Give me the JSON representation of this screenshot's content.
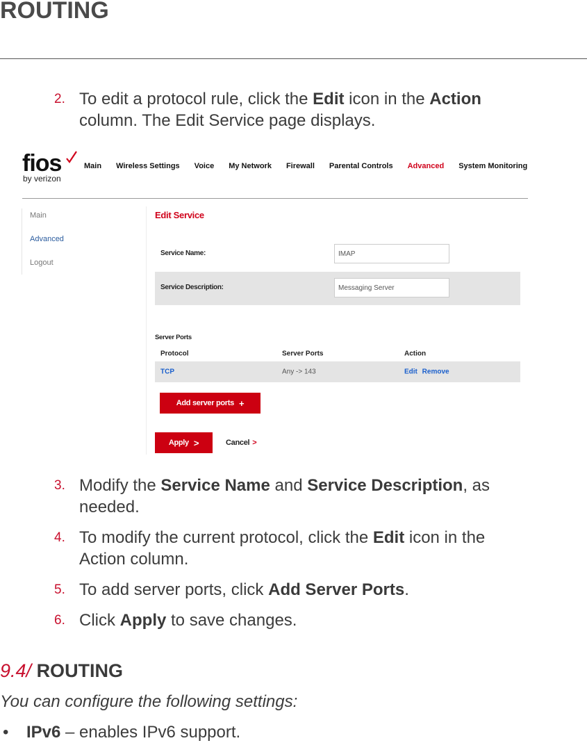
{
  "header": {
    "chapter_title": "ROUTING"
  },
  "steps_before": [
    {
      "number": "2.",
      "parts": [
        {
          "t": "To edit a protocol rule, click the "
        },
        {
          "t": "Edit",
          "b": true
        },
        {
          "t": " icon in the "
        },
        {
          "t": "Action",
          "b": true
        },
        {
          "t": " column. The Edit Service page displays."
        }
      ]
    }
  ],
  "screenshot": {
    "logo": {
      "brand": "fios",
      "sub": "by verizon",
      "check_color": "#d0021b"
    },
    "top_nav": [
      {
        "label": "Main",
        "active": false
      },
      {
        "label": "Wireless Settings",
        "active": false
      },
      {
        "label": "Voice",
        "active": false
      },
      {
        "label": "My Network",
        "active": false
      },
      {
        "label": "Firewall",
        "active": false
      },
      {
        "label": "Parental Controls",
        "active": false
      },
      {
        "label": "Advanced",
        "active": true
      },
      {
        "label": "System Monitoring",
        "active": false
      }
    ],
    "sidebar": [
      {
        "label": "Main",
        "active": false
      },
      {
        "label": "Advanced",
        "active": true
      },
      {
        "label": "Logout",
        "active": false
      }
    ],
    "page_title": "Edit Service",
    "form": {
      "service_name_label": "Service Name:",
      "service_name_value": "IMAP",
      "service_description_label": "Service Description:",
      "service_description_value": "Messaging Server"
    },
    "server_ports": {
      "title": "Server Ports",
      "columns": [
        "Protocol",
        "Server Ports",
        "Action"
      ],
      "rows": [
        {
          "protocol": "TCP",
          "ports": "Any -> 143",
          "edit": "Edit",
          "remove": "Remove"
        }
      ]
    },
    "add_server_ports_label": "Add server ports",
    "add_icon": "+",
    "apply_label": "Apply",
    "cancel_label": "Cancel",
    "chevron": ">",
    "colors": {
      "accent_red": "#cc0011",
      "link_blue": "#1a5fcc",
      "sidebar_active": "#2b5c9e"
    }
  },
  "steps_after": [
    {
      "number": "3.",
      "parts": [
        {
          "t": "Modify the "
        },
        {
          "t": "Service Name",
          "b": true
        },
        {
          "t": " and "
        },
        {
          "t": "Service Description",
          "b": true
        },
        {
          "t": ", as needed."
        }
      ]
    },
    {
      "number": "4.",
      "parts": [
        {
          "t": "To modify the current protocol, click the "
        },
        {
          "t": "Edit",
          "b": true
        },
        {
          "t": " icon in the Action column."
        }
      ]
    },
    {
      "number": "5.",
      "parts": [
        {
          "t": "To add server ports, click "
        },
        {
          "t": "Add Server Ports",
          "b": true
        },
        {
          "t": "."
        }
      ]
    },
    {
      "number": "6.",
      "parts": [
        {
          "t": "Click "
        },
        {
          "t": "Apply",
          "b": true
        },
        {
          "t": " to save changes."
        }
      ]
    }
  ],
  "section": {
    "number": "9.4/",
    "title": "ROUTING",
    "intro": "You can configure the following settings:",
    "bullets": [
      {
        "term": "IPv6",
        "desc": " – enables IPv6 support."
      }
    ]
  }
}
